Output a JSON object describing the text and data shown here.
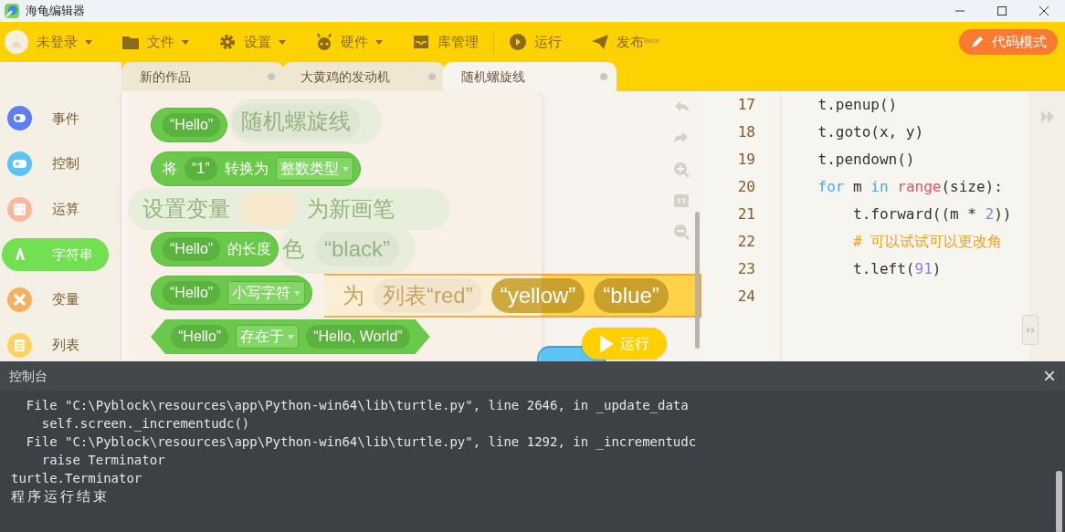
{
  "window": {
    "title": "海龟编辑器"
  },
  "toolbar": {
    "items": [
      {
        "kind": "user",
        "label": "未登录",
        "dropdown": true
      },
      {
        "kind": "folder",
        "label": "文件",
        "dropdown": true
      },
      {
        "kind": "gear",
        "label": "设置",
        "dropdown": true
      },
      {
        "kind": "robot",
        "label": "硬件",
        "dropdown": true
      },
      {
        "kind": "inbox",
        "label": "库管理",
        "dropdown": false
      },
      {
        "kind": "play",
        "label": "运行",
        "dropdown": false
      },
      {
        "kind": "send",
        "label": "发布$^{Beta}$",
        "dropdown": false
      }
    ],
    "mode_button": "代码模式"
  },
  "tabs": [
    {
      "label": "新的作品",
      "selected": false
    },
    {
      "label": "大黄鸡的发动机",
      "selected": false
    },
    {
      "label": "随机螺旋线",
      "selected": true
    }
  ],
  "categories": [
    {
      "kind": "event",
      "label": "事件",
      "color": "#5b7ff0",
      "selected": false
    },
    {
      "kind": "control",
      "label": "控制",
      "color": "#5cc3f5",
      "selected": false
    },
    {
      "kind": "math",
      "label": "运算",
      "color": "#f8b89c",
      "selected": false
    },
    {
      "kind": "string",
      "label": "字符串",
      "color": "#72e052",
      "selected": true
    },
    {
      "kind": "variable",
      "label": "变量",
      "color": "#f5b061",
      "selected": false
    },
    {
      "kind": "list",
      "label": "列表",
      "color": "#ffd35c",
      "selected": false
    }
  ],
  "workspace_blocks": [
    {
      "kind": "pill",
      "parts": [
        {
          "kind": "slot",
          "text": "随机螺旋线"
        }
      ]
    },
    {
      "kind": "stack",
      "parts": [
        {
          "kind": "text",
          "text": "设置变量"
        },
        {
          "kind": "var"
        },
        {
          "kind": "text",
          "text": "为新画笔"
        }
      ]
    },
    {
      "kind": "stack",
      "parts": [
        {
          "kind": "text",
          "text": "色"
        },
        {
          "kind": "slot",
          "text": "“black”"
        }
      ]
    },
    {
      "kind": "bar",
      "parts": [
        {
          "kind": "text",
          "text": "为"
        },
        {
          "kind": "slot",
          "text": "列表“red”"
        },
        {
          "kind": "slot",
          "text": "“yellow”"
        },
        {
          "kind": "slot",
          "text": "“blue”"
        }
      ]
    }
  ],
  "flyout": {
    "blocks": [
      {
        "kind": "reporter",
        "parts": [
          {
            "kind": "string",
            "text": "“Hello”"
          }
        ]
      },
      {
        "kind": "reporter",
        "parts": [
          {
            "kind": "text",
            "text": "将"
          },
          {
            "kind": "string",
            "text": "“1”"
          },
          {
            "kind": "text",
            "text": "转换为"
          },
          {
            "kind": "dropdown",
            "text": "整数类型"
          }
        ]
      },
      {
        "kind": "reporter",
        "parts": [
          {
            "kind": "string",
            "text": "“Hello”"
          },
          {
            "kind": "text",
            "text": "的长度"
          }
        ]
      },
      {
        "kind": "reporter",
        "parts": [
          {
            "kind": "string",
            "text": "“Hello”"
          },
          {
            "kind": "dropdown",
            "text": "小写字符"
          }
        ]
      },
      {
        "kind": "boolean",
        "parts": [
          {
            "kind": "string",
            "text": "“Hello”"
          },
          {
            "kind": "dropdown",
            "text": "存在于"
          },
          {
            "kind": "string",
            "text": "“Hello, World”"
          }
        ]
      }
    ]
  },
  "run_button": "运行",
  "code": {
    "lines": [
      {
        "number": "17",
        "tokens": [
          {
            "kind": "plain",
            "t": "    t.penup()"
          }
        ]
      },
      {
        "number": "18",
        "tokens": [
          {
            "kind": "plain",
            "t": "    t.goto(x, y)"
          }
        ]
      },
      {
        "number": "19",
        "tokens": [
          {
            "kind": "plain",
            "t": "    t.pendown()"
          }
        ]
      },
      {
        "number": "20",
        "tokens": [
          {
            "kind": "keyword",
            "t": "    for"
          },
          {
            "kind": "plain",
            "t": " m "
          },
          {
            "kind": "keyword",
            "t": "in"
          },
          {
            "kind": "builtin",
            "t": " range"
          },
          {
            "kind": "plain",
            "t": "(size):"
          }
        ]
      },
      {
        "number": "21",
        "tokens": [
          {
            "kind": "plain",
            "t": "        t.forward((m * "
          },
          {
            "kind": "number",
            "t": "2"
          },
          {
            "kind": "plain",
            "t": "))"
          }
        ]
      },
      {
        "number": "22",
        "tokens": [
          {
            "kind": "comment",
            "t": "        # 可以试试可以更改角"
          }
        ]
      },
      {
        "number": "23",
        "tokens": [
          {
            "kind": "plain",
            "t": "        t.left("
          },
          {
            "kind": "number",
            "t": "91"
          },
          {
            "kind": "plain",
            "t": ")"
          }
        ]
      },
      {
        "number": "24"
      }
    ]
  },
  "console": {
    "title": "控制台",
    "close": "×",
    "lines": [
      "  File \"C:\\Pyblock\\resources\\app\\Python-win64\\lib\\turtle.py\", line 2646, in _update_data",
      "    self.screen._incrementudc()",
      "  File \"C:\\Pyblock\\resources\\app\\Python-win64\\lib\\turtle.py\", line 1292, in _incrementudc",
      "    raise Terminator",
      "turtle.Terminator",
      "程序运行结束"
    ]
  }
}
